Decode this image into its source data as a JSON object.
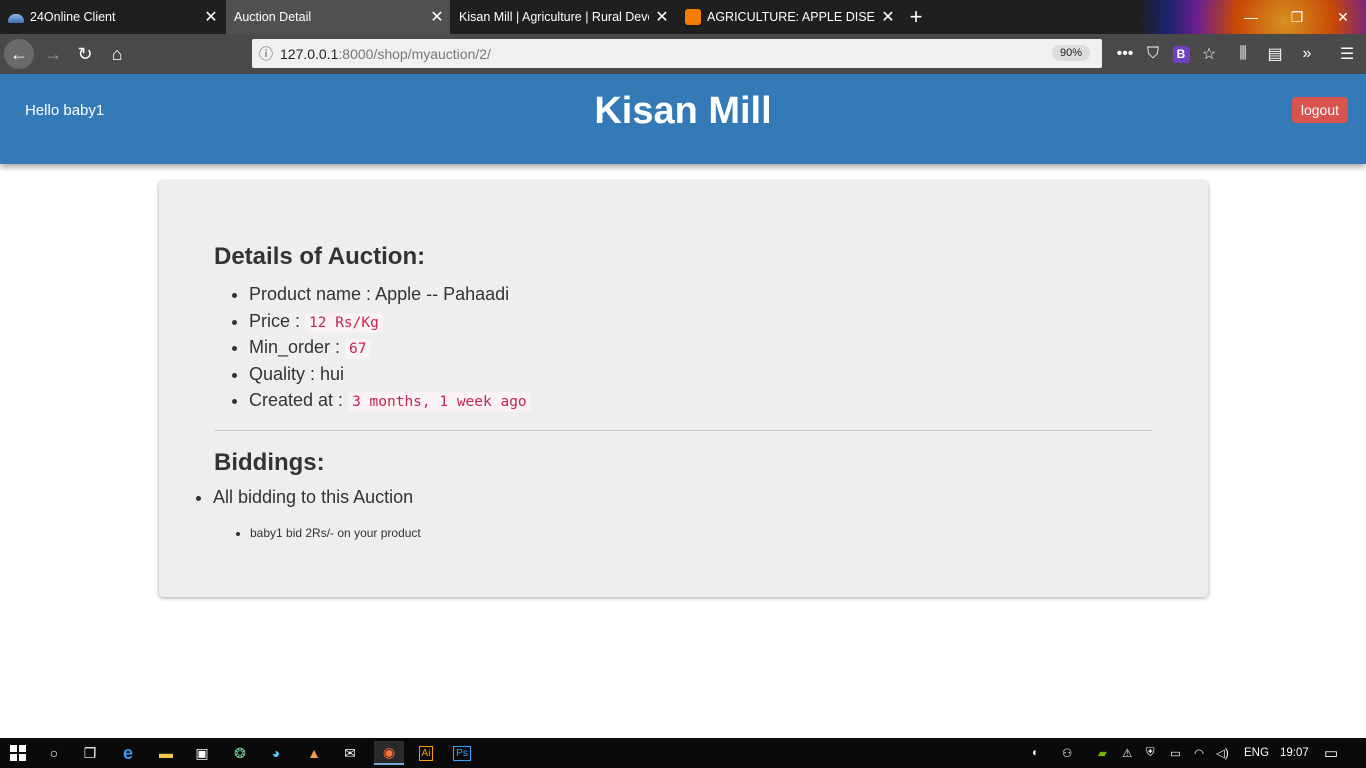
{
  "browser": {
    "tabs": [
      {
        "label": "24Online Client",
        "active": false
      },
      {
        "label": "Auction Detail",
        "active": true
      },
      {
        "label": "Kisan Mill | Agriculture | Rural Deve",
        "active": false
      },
      {
        "label": "AGRICULTURE: APPLE DISEASE",
        "active": false
      }
    ],
    "url_host": "127.0.0.1",
    "url_path": ":8000/shop/myauction/2/",
    "zoom": "90%",
    "reader_badge": "B"
  },
  "header": {
    "greeting": "Hello baby1",
    "brand": "Kisan Mill",
    "logout_label": "logout"
  },
  "auction": {
    "title": "Details of Auction:",
    "product_label": "Product name : ",
    "product_value": "Apple -- Pahaadi",
    "price_label": "Price : ",
    "price_value": "12 Rs/Kg",
    "min_order_label": "Min_order : ",
    "min_order_value": "67",
    "quality_label": "Quality : ",
    "quality_value": "hui",
    "created_label": "Created at : ",
    "created_value": "3 months, 1 week ago"
  },
  "biddings": {
    "title": "Biddings:",
    "all_label": "All bidding to this Auction",
    "bids": [
      "baby1 bid 2Rs/- on your product"
    ]
  },
  "taskbar": {
    "lang": "ENG",
    "time": "19:07",
    "ai_label": "Ai",
    "ps_label": "Ps"
  },
  "colors": {
    "header_bg": "#337ab7",
    "logout_bg": "#d9534f",
    "code_fg": "#c7254e"
  }
}
